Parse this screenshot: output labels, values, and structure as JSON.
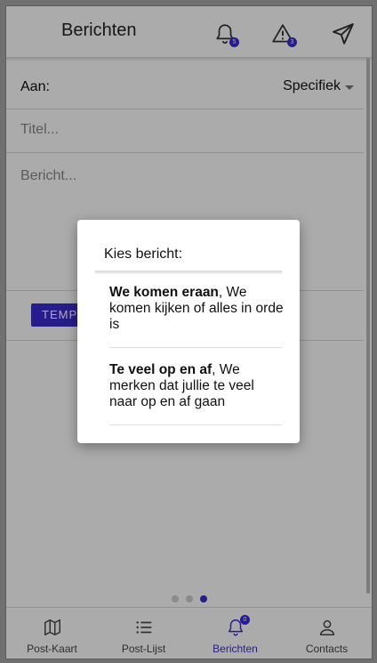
{
  "header": {
    "title": "Berichten",
    "notifications_count": "5",
    "warnings_count": "3"
  },
  "form": {
    "to_label": "Aan:",
    "to_value": "Specifiek",
    "title_placeholder": "Titel...",
    "message_placeholder": "Bericht...",
    "template_button": "TEMPLATE"
  },
  "dialog": {
    "title": "Kies bericht:",
    "options": [
      {
        "bold": "We komen eraan",
        "text": ", We komen kijken of alles in orde is"
      },
      {
        "bold": "Te veel op en af",
        "text": ", We merken dat jullie te veel naar op en af gaan"
      }
    ]
  },
  "nav": {
    "items": [
      {
        "label": "Post-Kaart",
        "icon": "map-icon"
      },
      {
        "label": "Post-Lijst",
        "icon": "list-icon"
      },
      {
        "label": "Berichten",
        "icon": "bell-icon",
        "badge": "0",
        "active": true
      },
      {
        "label": "Contacts",
        "icon": "user-icon"
      }
    ]
  },
  "page_indicator": {
    "total": 3,
    "active": 3
  },
  "colors": {
    "accent": "#3b2bd6",
    "overlay": "rgba(0,0,0,0.33)"
  }
}
